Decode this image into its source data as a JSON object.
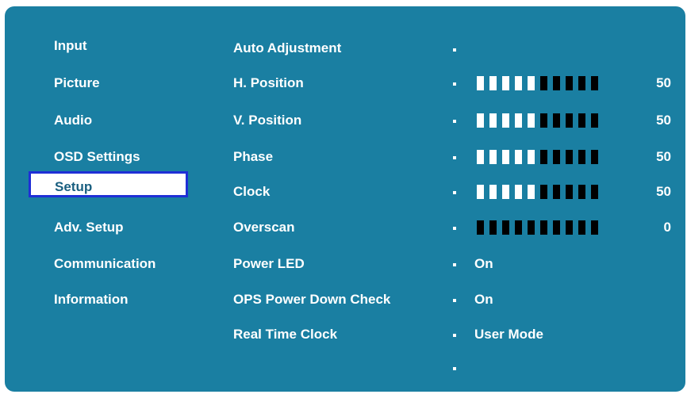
{
  "menu": {
    "items": [
      {
        "label": "Input"
      },
      {
        "label": "Picture"
      },
      {
        "label": "Audio"
      },
      {
        "label": "OSD Settings"
      },
      {
        "label": "Setup",
        "selected": true
      },
      {
        "label": "Adv. Setup"
      },
      {
        "label": "Communication"
      },
      {
        "label": "Information"
      }
    ]
  },
  "settings": [
    {
      "label": "Auto Adjustment"
    },
    {
      "label": "H. Position",
      "level": 0.5,
      "value": "50"
    },
    {
      "label": "V. Position",
      "level": 0.5,
      "value": "50"
    },
    {
      "label": "Phase",
      "level": 0.5,
      "value": "50"
    },
    {
      "label": "Clock",
      "level": 0.5,
      "value": "50"
    },
    {
      "label": "Overscan",
      "level": 0.0,
      "value": "0"
    },
    {
      "label": "Power LED",
      "value": "On"
    },
    {
      "label": "OPS Power Down Check",
      "value": "On"
    },
    {
      "label": "Real Time Clock",
      "value": "User Mode"
    }
  ],
  "colors": {
    "panel": "#1a7fa2",
    "selection_border": "#1f2fd6",
    "bar_on": "#ffffff",
    "bar_off": "#000000"
  }
}
